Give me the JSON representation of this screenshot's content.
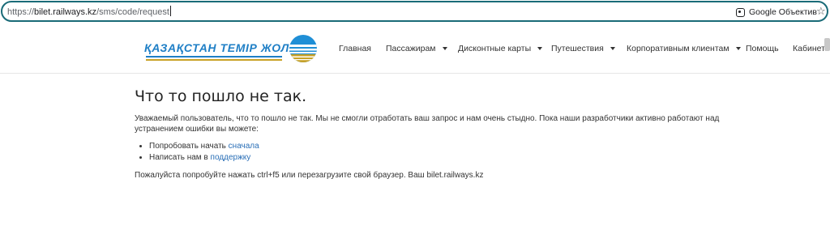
{
  "browser": {
    "url_scheme": "https://",
    "url_host": "bilet.railways.kz",
    "url_path": "/sms/code/request",
    "lens_label": "Google Объектив"
  },
  "logo": {
    "text": "ҚАЗАҚСТАН ТЕМІР ЖОЛЫ"
  },
  "nav": {
    "items": [
      {
        "label": "Главная",
        "dropdown": false
      },
      {
        "label": "Пассажирам",
        "dropdown": true
      },
      {
        "label": "Дисконтные карты",
        "dropdown": true
      },
      {
        "label": "Путешествия",
        "dropdown": true
      },
      {
        "label": "Корпоративным клиентам",
        "dropdown": true
      },
      {
        "label": "Помощь",
        "dropdown": false
      },
      {
        "label": "Кабинет",
        "dropdown": true
      }
    ]
  },
  "error": {
    "title": "Что то пошло не так.",
    "message": "Уважаемый пользователь, что то пошло не так. Мы не смогли отработать ваш запрос и нам очень стыдно. Пока наши разработчики активно работают над устранением ошибки вы можете:",
    "options": [
      {
        "prefix": "Попробовать начать ",
        "link": "сначала"
      },
      {
        "prefix": "Написать нам в ",
        "link": "поддержку"
      }
    ],
    "hint": "Пожалуйста попробуйте нажать ctrl+f5 или перезагрузите свой браузер. Ваш bilet.railways.kz"
  },
  "colors": {
    "link": "#2a6fb7",
    "logo_blue": "#1f7fc6",
    "logo_gold": "#c9a227",
    "address_border": "#1a6b78"
  }
}
